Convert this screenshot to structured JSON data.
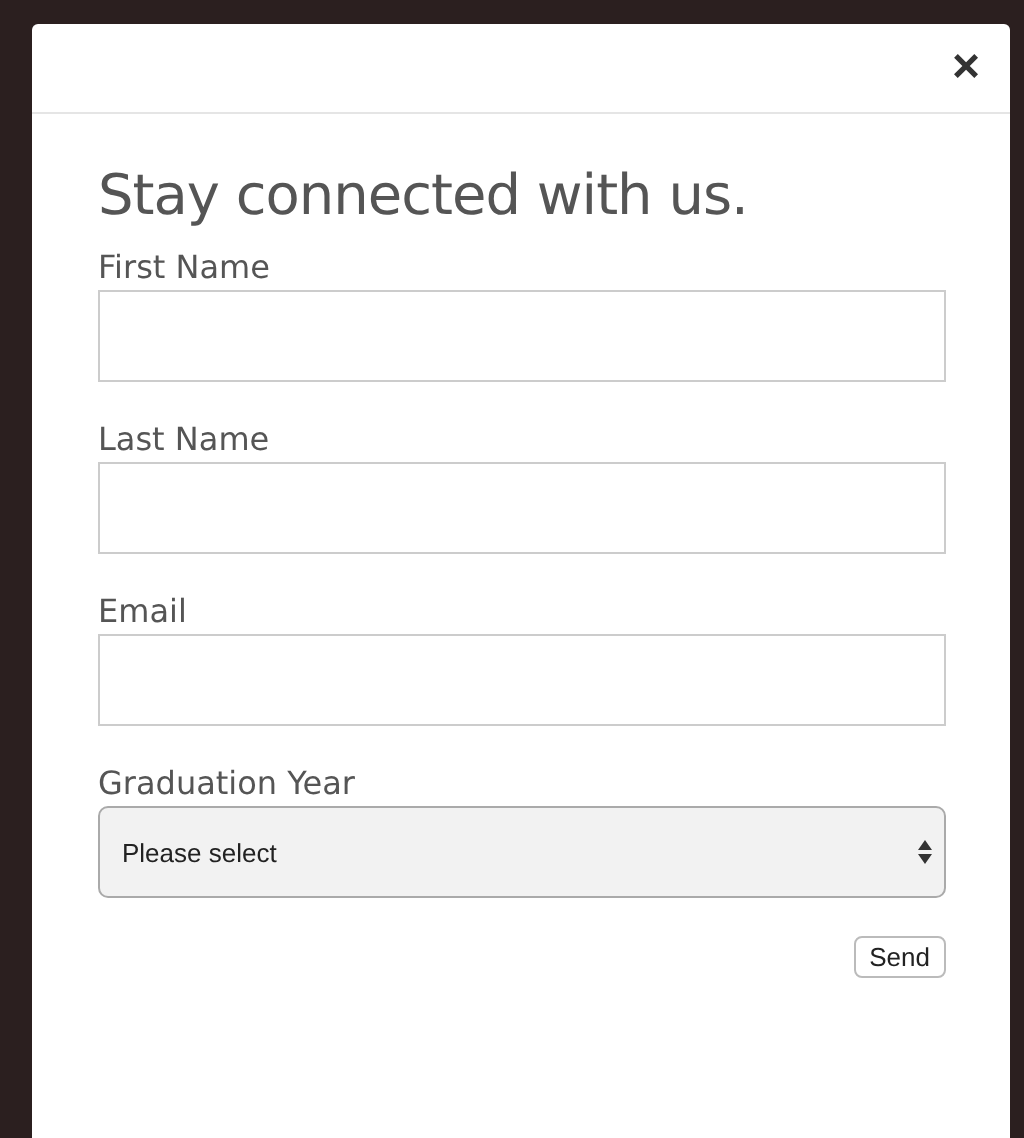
{
  "dialog": {
    "close": "×",
    "title": "Stay connected with us.",
    "fields": [
      {
        "kind": "text",
        "label": "First Name"
      },
      {
        "kind": "text",
        "label": "Last Name"
      },
      {
        "kind": "text",
        "label": "Email"
      },
      {
        "kind": "select",
        "label": "Graduation Year",
        "value": "Please select"
      }
    ],
    "submit": "Send"
  }
}
